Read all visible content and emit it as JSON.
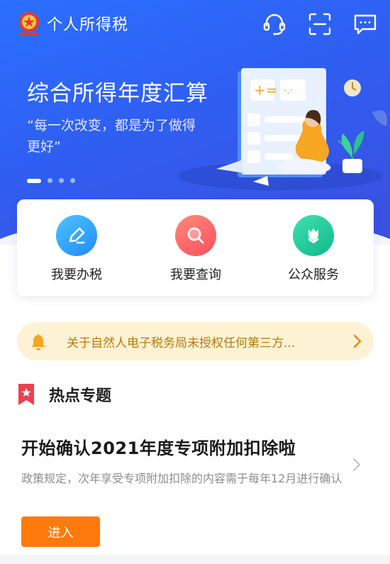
{
  "header": {
    "title": "个人所得税",
    "icons": [
      "emblem-icon",
      "customer-service-icon",
      "scan-icon",
      "message-icon"
    ]
  },
  "banner": {
    "title": "综合所得年度汇算",
    "quote": "“每一次改变，都是为了做得更好”",
    "carousel": {
      "slides": 4,
      "active": 1
    }
  },
  "quick_actions": [
    {
      "label": "我要办税",
      "icon": "edit-icon",
      "color": "#1e8bff"
    },
    {
      "label": "我要查询",
      "icon": "search-icon",
      "color": "#ff4e5e"
    },
    {
      "label": "公众服务",
      "icon": "tulip-icon",
      "color": "#10b98a"
    }
  ],
  "notice": {
    "text": "关于自然人电子税务局未授权任何第三方...",
    "icon": "bell-icon"
  },
  "hot_topics": {
    "section_title": "热点专题",
    "item": {
      "title": "开始确认2021年度专项附加扣除啦",
      "description": "政策规定，次年享受专项附加扣除的内容需于每年12月进行确认",
      "button": "进入"
    }
  },
  "colors": {
    "primary": "#2f5ff2",
    "accent": "#ff7a0c",
    "notice_bg": "#fdf2d3",
    "notice_text": "#b9790c"
  }
}
